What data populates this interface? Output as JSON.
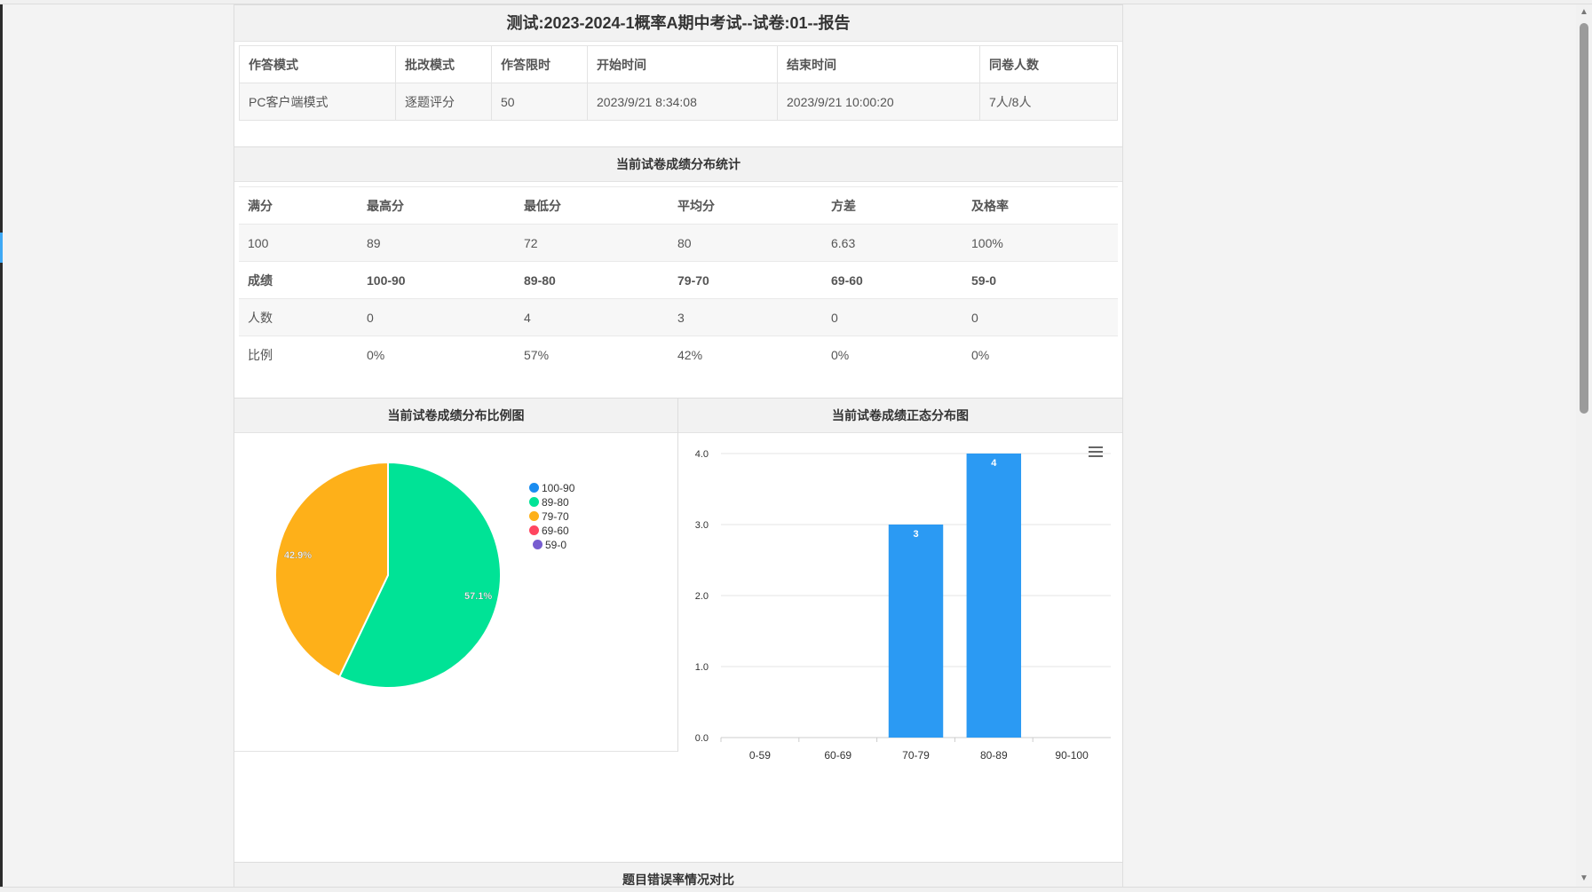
{
  "report_title": "测试:2023-2024-1概率A期中考试--试卷:01--报告",
  "info_table": {
    "headers": [
      "作答模式",
      "批改模式",
      "作答限时",
      "开始时间",
      "结束时间",
      "同卷人数"
    ],
    "values": [
      "PC客户端模式",
      "逐题评分",
      "50",
      "2023/9/21 8:34:08",
      "2023/9/21 10:00:20",
      "7人/8人"
    ]
  },
  "stats_section": {
    "title": "当前试卷成绩分布统计",
    "row1_labels": [
      "满分",
      "最高分",
      "最低分",
      "平均分",
      "方差",
      "及格率"
    ],
    "row1_values": [
      "100",
      "89",
      "72",
      "80",
      "6.63",
      "100%"
    ],
    "row2_labels": [
      "成绩",
      "100-90",
      "89-80",
      "79-70",
      "69-60",
      "59-0"
    ],
    "row3": [
      "人数",
      "0",
      "4",
      "3",
      "0",
      "0"
    ],
    "row4": [
      "比例",
      "0%",
      "57%",
      "42%",
      "0%",
      "0%"
    ]
  },
  "pie_chart": {
    "title": "当前试卷成绩分布比例图",
    "chart_data": {
      "type": "pie",
      "slices": [
        {
          "label": "100-90",
          "value": 0,
          "color": "#1a8cf0"
        },
        {
          "label": "89-80",
          "value": 57.1,
          "color": "#00e396"
        },
        {
          "label": "79-70",
          "value": 42.9,
          "color": "#feb019"
        },
        {
          "label": "69-60",
          "value": 0,
          "color": "#ff4560"
        },
        {
          "label": "59-0",
          "value": 0,
          "color": "#775dd0"
        }
      ],
      "data_labels": [
        "57.1%",
        "42.9%"
      ]
    }
  },
  "bar_chart": {
    "title": "当前试卷成绩正态分布图",
    "chart_data": {
      "type": "bar",
      "categories": [
        "0-59",
        "60-69",
        "70-79",
        "80-89",
        "90-100"
      ],
      "values": [
        0,
        0,
        3,
        4,
        0
      ],
      "data_labels": [
        "",
        "",
        "3",
        "4",
        ""
      ],
      "yticks": [
        "0.0",
        "1.0",
        "2.0",
        "3.0",
        "4.0"
      ],
      "ylim": [
        0,
        4
      ],
      "bar_color": "#2b9af3",
      "grid": true
    }
  },
  "next_section_title": "题目错误率情况对比"
}
